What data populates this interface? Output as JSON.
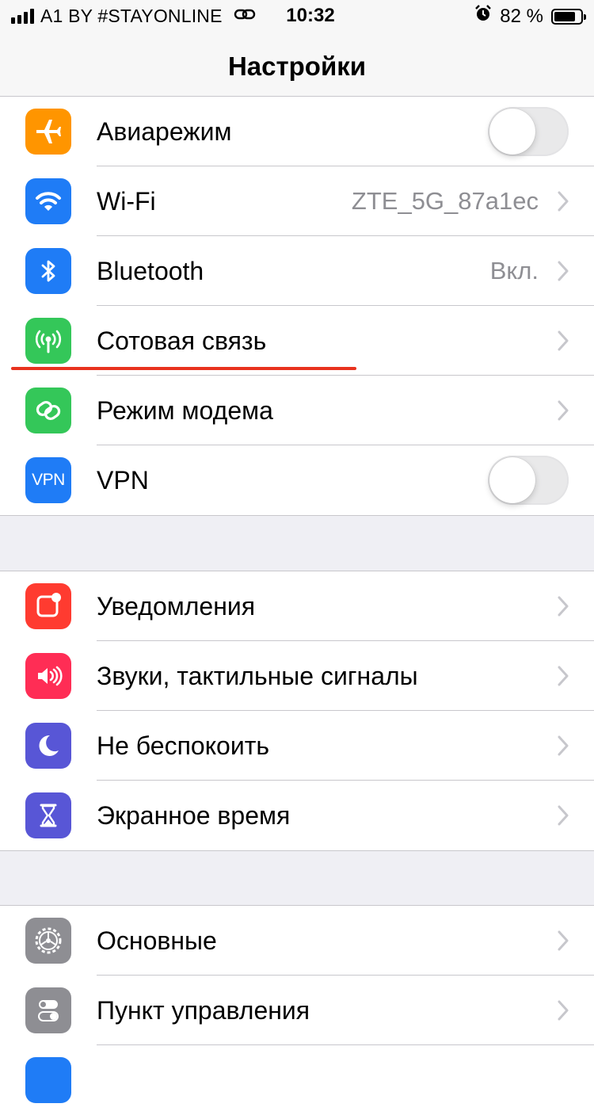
{
  "status_bar": {
    "carrier": "A1 BY #STAYONLINE",
    "time": "10:32",
    "battery_percent_text": "82 %",
    "battery_level": 0.82,
    "icons": [
      "signal-icon",
      "hotspot-link-icon",
      "alarm-icon",
      "battery-icon"
    ]
  },
  "nav": {
    "title": "Настройки"
  },
  "groups": [
    {
      "rows": [
        {
          "label": "Авиарежим",
          "icon": "airplane-icon",
          "icon_color": "#ff9500",
          "control": "toggle",
          "on": false
        },
        {
          "label": "Wi-Fi",
          "icon": "wifi-icon",
          "icon_color": "#1f7cf6",
          "value": "ZTE_5G_87a1ec",
          "control": "chevron"
        },
        {
          "label": "Bluetooth",
          "icon": "bluetooth-icon",
          "icon_color": "#1f7cf6",
          "value": "Вкл.",
          "control": "chevron"
        },
        {
          "label": "Сотовая связь",
          "icon": "cellular-antenna-icon",
          "icon_color": "#34c759",
          "control": "chevron"
        },
        {
          "label": "Режим модема",
          "icon": "hotspot-icon",
          "icon_color": "#34c759",
          "control": "chevron"
        },
        {
          "label": "VPN",
          "icon": "vpn-icon",
          "icon_text": "VPN",
          "icon_color": "#1f7cf6",
          "control": "toggle",
          "on": false
        }
      ]
    },
    {
      "rows": [
        {
          "label": "Уведомления",
          "icon": "notifications-icon",
          "icon_color": "#ff3b30",
          "control": "chevron"
        },
        {
          "label": "Звуки, тактильные сигналы",
          "icon": "sounds-icon",
          "icon_color": "#ff2d55",
          "control": "chevron"
        },
        {
          "label": "Не беспокоить",
          "icon": "moon-icon",
          "icon_color": "#5856d6",
          "control": "chevron"
        },
        {
          "label": "Экранное время",
          "icon": "hourglass-icon",
          "icon_color": "#5856d6",
          "control": "chevron"
        }
      ]
    },
    {
      "rows": [
        {
          "label": "Основные",
          "icon": "gear-icon",
          "icon_color": "#8e8e93",
          "control": "chevron"
        },
        {
          "label": "Пункт управления",
          "icon": "control-center-icon",
          "icon_color": "#8e8e93",
          "control": "chevron"
        }
      ]
    }
  ],
  "annotation": {
    "type": "underline",
    "color": "#e8321e",
    "target": "Сотовая связь"
  }
}
